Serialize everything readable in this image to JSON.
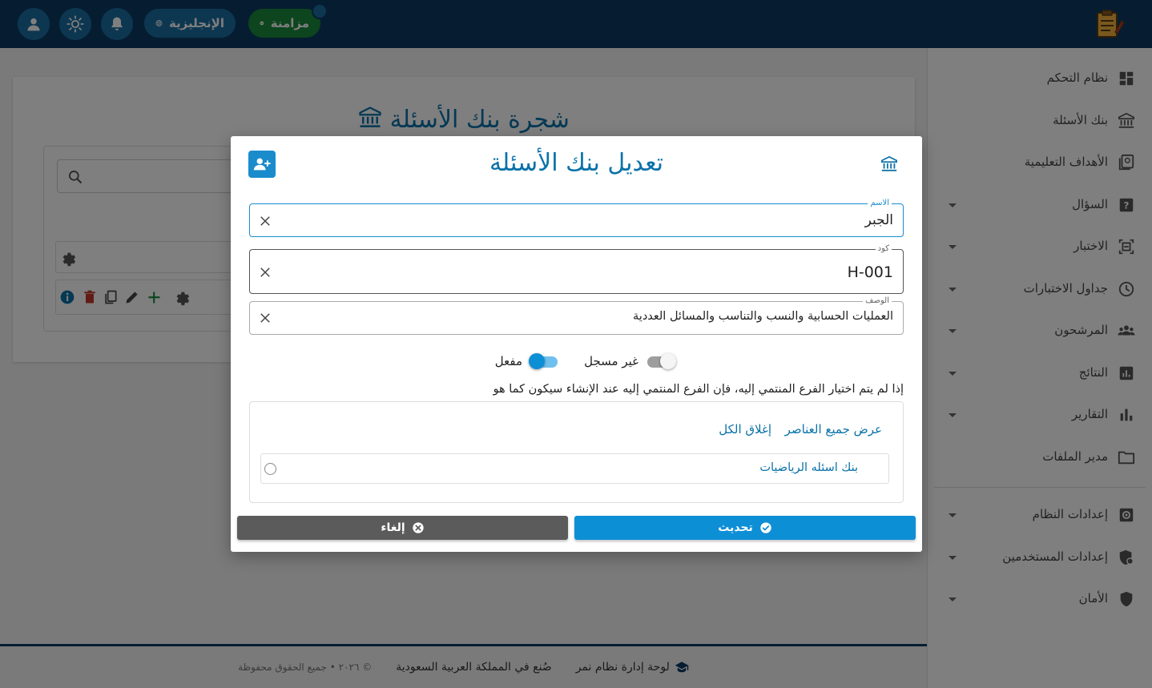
{
  "topbar": {
    "language_label": "الإنجليزية",
    "sync_label": "مزامنة",
    "colors": {
      "bar": "#0c3a63",
      "circle": "#1a6fa3",
      "sync": "#1b8a3c"
    },
    "icons": [
      "user-icon",
      "sun-icon",
      "bell-icon",
      "globe-icon",
      "check-circle-icon"
    ]
  },
  "sidebar": {
    "items": [
      {
        "label": "نظام التحكم",
        "icon": "dashboard-icon",
        "caret": false
      },
      {
        "label": "بنك الأسئلة",
        "icon": "bank-icon",
        "caret": false
      },
      {
        "label": "الأهداف التعليمية",
        "icon": "objectives-icon",
        "caret": false
      },
      {
        "label": "السؤال",
        "icon": "question-icon",
        "caret": true
      },
      {
        "label": "الاختبار",
        "icon": "exam-icon",
        "caret": true
      },
      {
        "label": "جداول الاختبارات",
        "icon": "clock-icon",
        "caret": true
      },
      {
        "label": "المرشحون",
        "icon": "people-icon",
        "caret": true
      },
      {
        "label": "النتائج",
        "icon": "results-icon",
        "caret": true
      },
      {
        "label": "التقارير",
        "icon": "reports-icon",
        "caret": true
      },
      {
        "label": "مدير الملفات",
        "icon": "folder-icon",
        "caret": false
      },
      {
        "label": "إعدادات النظام",
        "icon": "system-settings-icon",
        "caret": true
      },
      {
        "label": "إعدادات المستخدمين",
        "icon": "user-settings-icon",
        "caret": true
      },
      {
        "label": "الأمان",
        "icon": "shield-icon",
        "caret": true
      }
    ]
  },
  "page": {
    "title": "شجرة بنك الأسئلة"
  },
  "footer": {
    "brand": "لوحة إدارة نظام نمر",
    "made_in": "صُنع في المملكة العربية السعودية",
    "copyright": "© ٢٠٢٦ • جميع الحقوق محفوظة"
  },
  "modal": {
    "title": "تعديل بنك الأسئلة",
    "fields": {
      "name": {
        "label": "الاسم",
        "value": "الجبر"
      },
      "code": {
        "label": "كود",
        "value": "H-001"
      },
      "description": {
        "label": "الوصف",
        "value": "العمليات الحسابية والنسب والتناسب والمسائل العددية"
      }
    },
    "toggles": {
      "registered": {
        "label": "غير مسجل",
        "on": false
      },
      "active": {
        "label": "مفعل",
        "on": true
      }
    },
    "hint": "إذا لم يتم اختيار الفرع المنتمي إليه، فإن الفرع المنتمي إليه عند الإنشاء سيكون كما هو",
    "tree": {
      "expand_all": "عرض جميع العناصر",
      "collapse_all": "إغلاق الكل",
      "nodes": [
        {
          "label": "بنك اسئله الرياضيات"
        }
      ]
    },
    "buttons": {
      "update": "تحديث",
      "cancel": "إلغاء"
    },
    "colors": {
      "accent": "#0a72a8",
      "update": "#0d8fd6",
      "cancel": "#5b5b5b"
    }
  }
}
